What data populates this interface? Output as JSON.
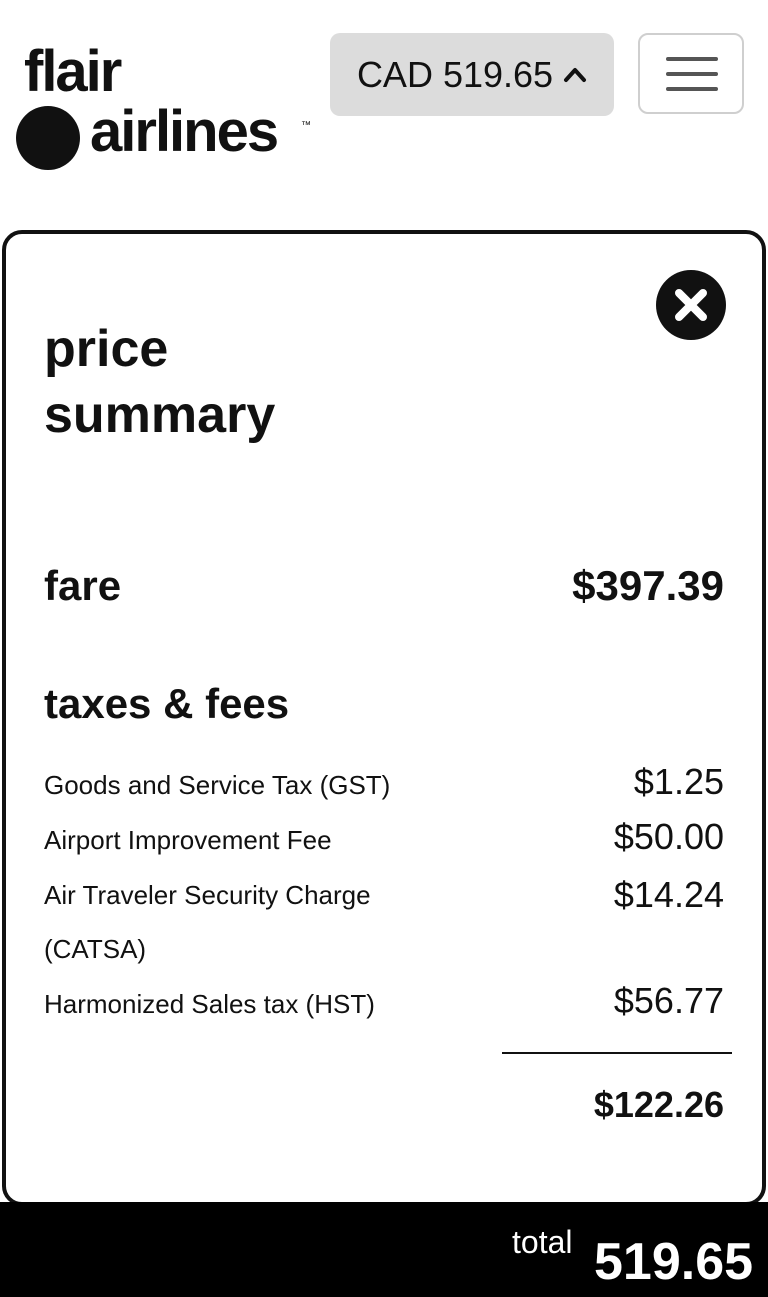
{
  "header": {
    "logo_line1": "flair",
    "logo_line2": "airlines",
    "logo_tm": "™",
    "price_button": "CAD 519.65",
    "menu_icon": "hamburger-menu-icon"
  },
  "summary": {
    "title_line1": "price",
    "title_line2": "summary",
    "fare_label": "fare",
    "fare_value": "$397.39",
    "taxes_title": "taxes & fees",
    "fees": [
      {
        "label": "Goods and Service Tax (GST)",
        "value": "$1.25"
      },
      {
        "label": "Airport Improvement Fee",
        "value": "$50.00"
      },
      {
        "label": "Air Traveler Security Charge (CATSA)",
        "value": "$14.24"
      },
      {
        "label": "Harmonized Sales tax (HST)",
        "value": "$56.77"
      }
    ],
    "taxes_subtotal": "$122.26"
  },
  "footer": {
    "total_label": "total",
    "total_value": "519.65"
  },
  "colors": {
    "accent": "#111111",
    "price_button_bg": "#dcdcdc",
    "footer_bg": "#000000"
  }
}
